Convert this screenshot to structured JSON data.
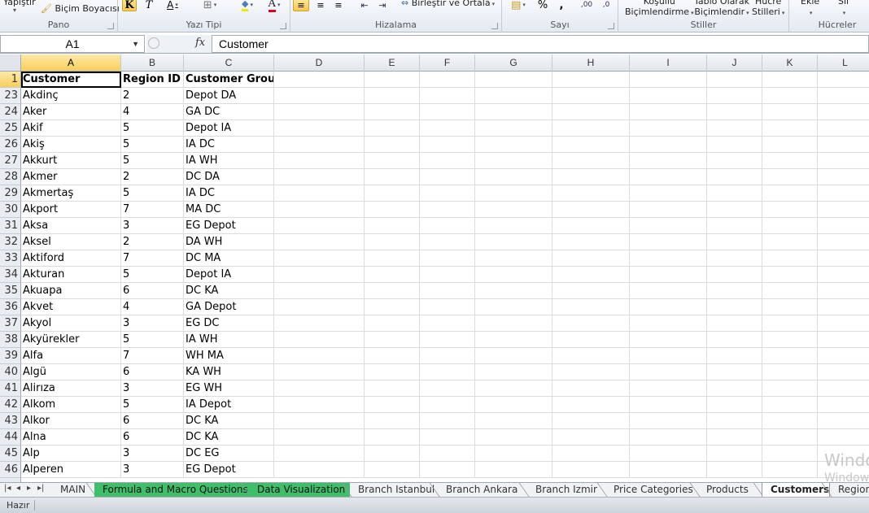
{
  "ribbon": {
    "groups": [
      {
        "label": "Pano",
        "buttons": [
          "Yapıştır",
          "Biçim Boyacısı"
        ]
      },
      {
        "label": "Yazı Tipi",
        "buttons": [
          "K",
          "T",
          "A"
        ]
      },
      {
        "label": "Hizalama",
        "buttons": [
          "Birleştir ve Ortala"
        ]
      },
      {
        "label": "Sayı",
        "buttons": [
          "%",
          ","
        ]
      },
      {
        "label": "Stiller",
        "buttons": [
          "Koşullu Biçimlendirme",
          "Tablo Olarak Biçimlendir",
          "Hücre Stilleri"
        ]
      },
      {
        "label": "Hücreler",
        "buttons": [
          "Ekle",
          "Sil"
        ]
      }
    ],
    "paste_label": "Yapıştır",
    "format_painter_label": "Biçim Boyacısı",
    "bold_label": "K",
    "italic_label": "T",
    "underline_label": "A",
    "font_color_label": "A",
    "merge_label": "Birleştir ve Ortala",
    "percent_label": "%",
    "comma_label": ",",
    "cond_format_line1": "Koşullu",
    "cond_format_line2": "Biçimlendirme",
    "table_format_line1": "Tablo Olarak",
    "table_format_line2": "Biçimlendir",
    "cell_styles_line1": "Hücre",
    "cell_styles_line2": "Stilleri",
    "insert_label": "Ekle",
    "delete_label": "Sil"
  },
  "formula_bar": {
    "name_box": "A1",
    "fx": "fx",
    "content": "Customer"
  },
  "columns": [
    "A",
    "B",
    "C",
    "D",
    "E",
    "F",
    "G",
    "H",
    "I",
    "J",
    "K",
    "L"
  ],
  "selected_column": "A",
  "header_row": {
    "row": "1",
    "cells": [
      "Customer",
      "Region ID",
      "Customer Group"
    ]
  },
  "rows": [
    {
      "row": "23",
      "cells": [
        "Akdinç",
        "2",
        "Depot DA"
      ]
    },
    {
      "row": "24",
      "cells": [
        "Aker",
        "4",
        "GA DC"
      ]
    },
    {
      "row": "25",
      "cells": [
        "Akif",
        "5",
        "Depot IA"
      ]
    },
    {
      "row": "26",
      "cells": [
        "Akiş",
        "5",
        "IA DC"
      ]
    },
    {
      "row": "27",
      "cells": [
        "Akkurt",
        "5",
        "IA WH"
      ]
    },
    {
      "row": "28",
      "cells": [
        "Akmer",
        "2",
        "DC DA"
      ]
    },
    {
      "row": "29",
      "cells": [
        "Akmertaş",
        "5",
        "IA DC"
      ]
    },
    {
      "row": "30",
      "cells": [
        "Akport",
        "7",
        "MA DC"
      ]
    },
    {
      "row": "31",
      "cells": [
        "Aksa",
        "3",
        "EG Depot"
      ]
    },
    {
      "row": "32",
      "cells": [
        "Aksel",
        "2",
        "DA WH"
      ]
    },
    {
      "row": "33",
      "cells": [
        "Aktiford",
        "7",
        "DC MA"
      ]
    },
    {
      "row": "34",
      "cells": [
        "Akturan",
        "5",
        "Depot IA"
      ]
    },
    {
      "row": "35",
      "cells": [
        "Akuapa",
        "6",
        "DC KA"
      ]
    },
    {
      "row": "36",
      "cells": [
        "Akvet",
        "4",
        "GA Depot"
      ]
    },
    {
      "row": "37",
      "cells": [
        "Akyol",
        "3",
        "EG DC"
      ]
    },
    {
      "row": "38",
      "cells": [
        "Akyürekler",
        "5",
        "IA WH"
      ]
    },
    {
      "row": "39",
      "cells": [
        "Alfa",
        "7",
        "WH MA"
      ]
    },
    {
      "row": "40",
      "cells": [
        "Algü",
        "6",
        "KA WH"
      ]
    },
    {
      "row": "41",
      "cells": [
        "Alirıza",
        "3",
        "EG WH"
      ]
    },
    {
      "row": "42",
      "cells": [
        "Alkom",
        "5",
        "IA Depot"
      ]
    },
    {
      "row": "43",
      "cells": [
        "Alkor",
        "6",
        "DC KA"
      ]
    },
    {
      "row": "44",
      "cells": [
        "Alna",
        "6",
        "DC KA"
      ]
    },
    {
      "row": "45",
      "cells": [
        "Alp",
        "3",
        "DC EG"
      ]
    },
    {
      "row": "46",
      "cells": [
        "Alperen",
        "3",
        "EG Depot"
      ]
    }
  ],
  "sheet_tabs": [
    {
      "label": "MAIN",
      "color": "",
      "active": false
    },
    {
      "label": "Formula and Macro Questions",
      "color": "#3fbf6a",
      "active": false
    },
    {
      "label": "Data Visualization",
      "color": "#3fbf6a",
      "active": false
    },
    {
      "label": "Branch Istanbul",
      "color": "",
      "active": false
    },
    {
      "label": "Branch Ankara",
      "color": "",
      "active": false
    },
    {
      "label": "Branch Izmir",
      "color": "",
      "active": false
    },
    {
      "label": "Price Categories",
      "color": "",
      "active": false
    },
    {
      "label": "Products",
      "color": "",
      "active": false
    },
    {
      "label": "Customers",
      "color": "",
      "active": true
    },
    {
      "label": "Regions",
      "color": "",
      "active": false
    }
  ],
  "status": {
    "text": "Hazır"
  },
  "watermark": {
    "line1": "Windo",
    "line2": "Window"
  }
}
